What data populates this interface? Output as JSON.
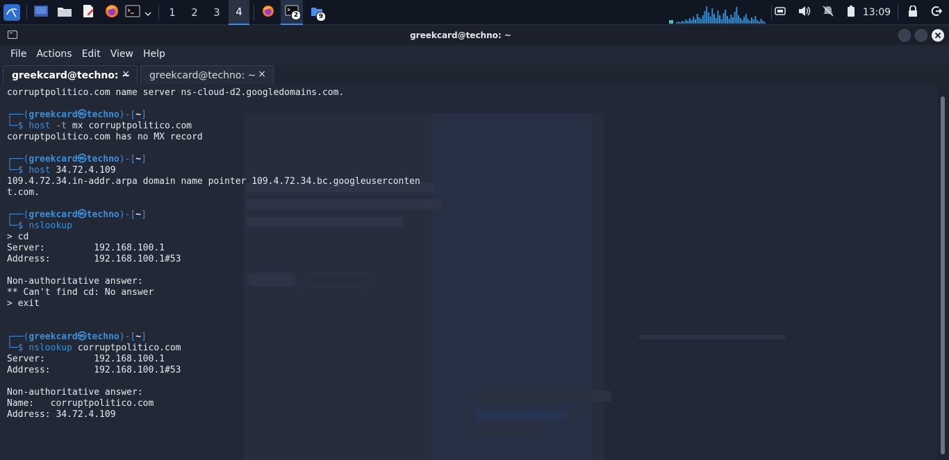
{
  "taskbar": {
    "workspaces": [
      "1",
      "2",
      "3",
      "4"
    ],
    "active_workspace": "4",
    "terminal_badge": "2",
    "files_badge": "9",
    "clock": "13:09",
    "icons": [
      "kali-menu-icon",
      "desktop-icon",
      "file-manager-icon",
      "text-editor-icon",
      "firefox-icon",
      "terminal-icon",
      "chevron-down-icon",
      "volume-icon",
      "notifications-muted-icon",
      "battery-icon",
      "lock-icon",
      "logout-icon"
    ]
  },
  "window": {
    "title": "greekcard@techno: ~"
  },
  "menu": [
    "File",
    "Actions",
    "Edit",
    "View",
    "Help"
  ],
  "tabs": [
    {
      "label": "greekcard@techno: ~",
      "close": "×",
      "active": true
    },
    {
      "label": "greekcard@techno: ~",
      "close": "×",
      "active": false
    }
  ],
  "prompt": {
    "user": "greekcard",
    "sep": "㉿",
    "host": "techno",
    "dir": "~",
    "top_left": "┌──(",
    "top_mid": ")-[",
    "top_right": "]",
    "bottom": "└─$ "
  },
  "terminal": {
    "l0": "corruptpolitico.com name server ns-cloud-d2.googledomains.com.",
    "c1_cmd": "host",
    "c1_flag": " -t",
    "c1_arg": " mx corruptpolitico.com",
    "o1": "corruptpolitico.com has no MX record",
    "c2_cmd": "host",
    "c2_arg": " 34.72.4.109",
    "o2a": "109.4.72.34.in-addr.arpa domain name pointer 109.4.72.34.bc.googleuserconten",
    "o2b": "t.com.",
    "c3_cmd": "nslookup",
    "o3a": "> cd",
    "o3b": "Server:         192.168.100.1",
    "o3c": "Address:        192.168.100.1#53",
    "o3d": "Non-authoritative answer:",
    "o3e": "** Can't find cd: No answer",
    "o3f": "> exit",
    "c4_cmd": "nslookup",
    "c4_arg": " corruptpolitico.com",
    "o4a": "Server:         192.168.100.1",
    "o4b": "Address:        192.168.100.1#53",
    "o4c": "Non-authoritative answer:",
    "o4d": "Name:   corruptpolitico.com",
    "o4e": "Address: 34.72.4.109"
  },
  "colors": {
    "prompt_blue": "#3d8fd9",
    "terminal_bg": "#222836",
    "accent": "#3d8cf0"
  }
}
